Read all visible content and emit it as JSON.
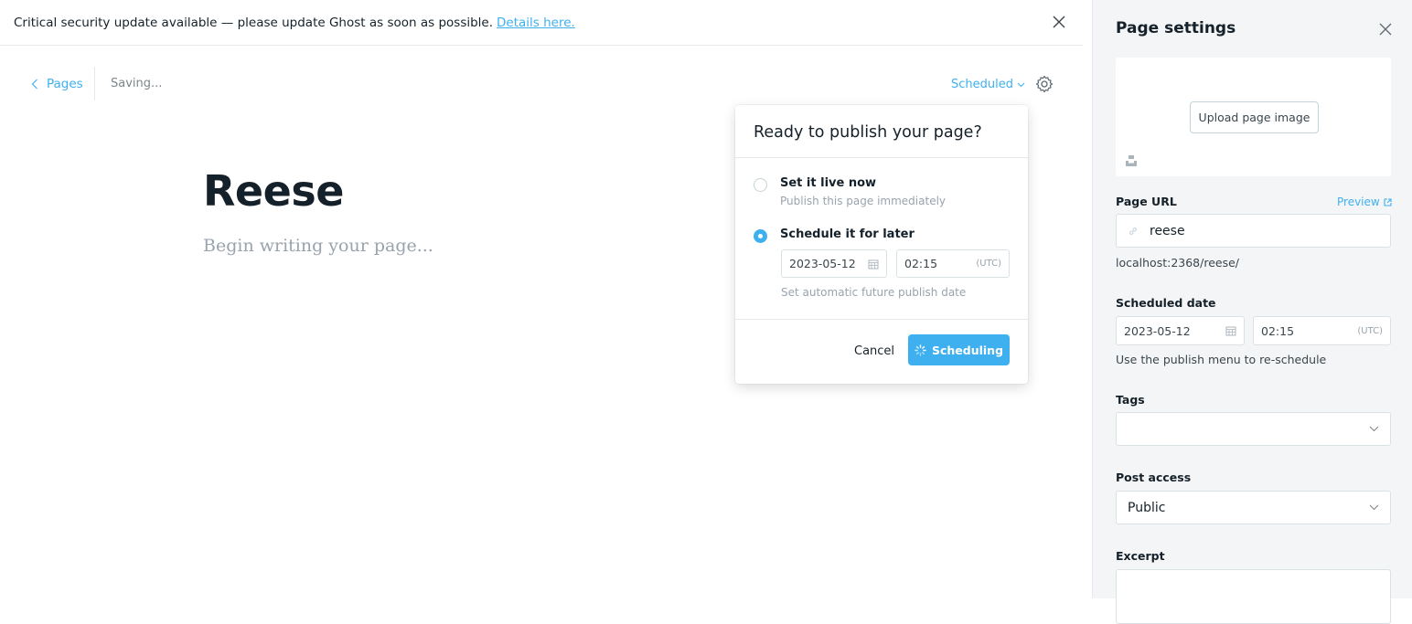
{
  "banner": {
    "message": "Critical security update available — please update Ghost as soon as possible.",
    "link": "Details here."
  },
  "header": {
    "back_label": "Pages",
    "save_status": "Saving...",
    "status_dropdown": "Scheduled"
  },
  "editor": {
    "title": "Reese",
    "body_placeholder": "Begin writing your page..."
  },
  "publish_menu": {
    "heading": "Ready to publish your page?",
    "options": [
      {
        "title": "Set it live now",
        "subtitle": "Publish this page immediately",
        "selected": false
      },
      {
        "title": "Schedule it for later",
        "subtitle": "",
        "selected": true
      }
    ],
    "date": "2023-05-12",
    "time": "02:15",
    "timezone": "(UTC)",
    "hint": "Set automatic future publish date",
    "cancel_label": "Cancel",
    "schedule_label": "Scheduling"
  },
  "settings": {
    "title": "Page settings",
    "upload_label": "Upload page image",
    "url_label": "Page URL",
    "preview_label": "Preview",
    "slug": "reese",
    "full_url": "localhost:2368/reese/",
    "scheduled_label": "Scheduled date",
    "scheduled_date": "2023-05-12",
    "scheduled_time": "02:15",
    "timezone": "(UTC)",
    "reschedule_hint": "Use the publish menu to re-schedule",
    "tags_label": "Tags",
    "tags_value": "",
    "access_label": "Post access",
    "access_value": "Public",
    "excerpt_label": "Excerpt"
  },
  "colors": {
    "accent": "#3eb0ef",
    "text": "#15212a",
    "muted": "#99a3ad",
    "panel_bg": "#f4f5f6"
  }
}
